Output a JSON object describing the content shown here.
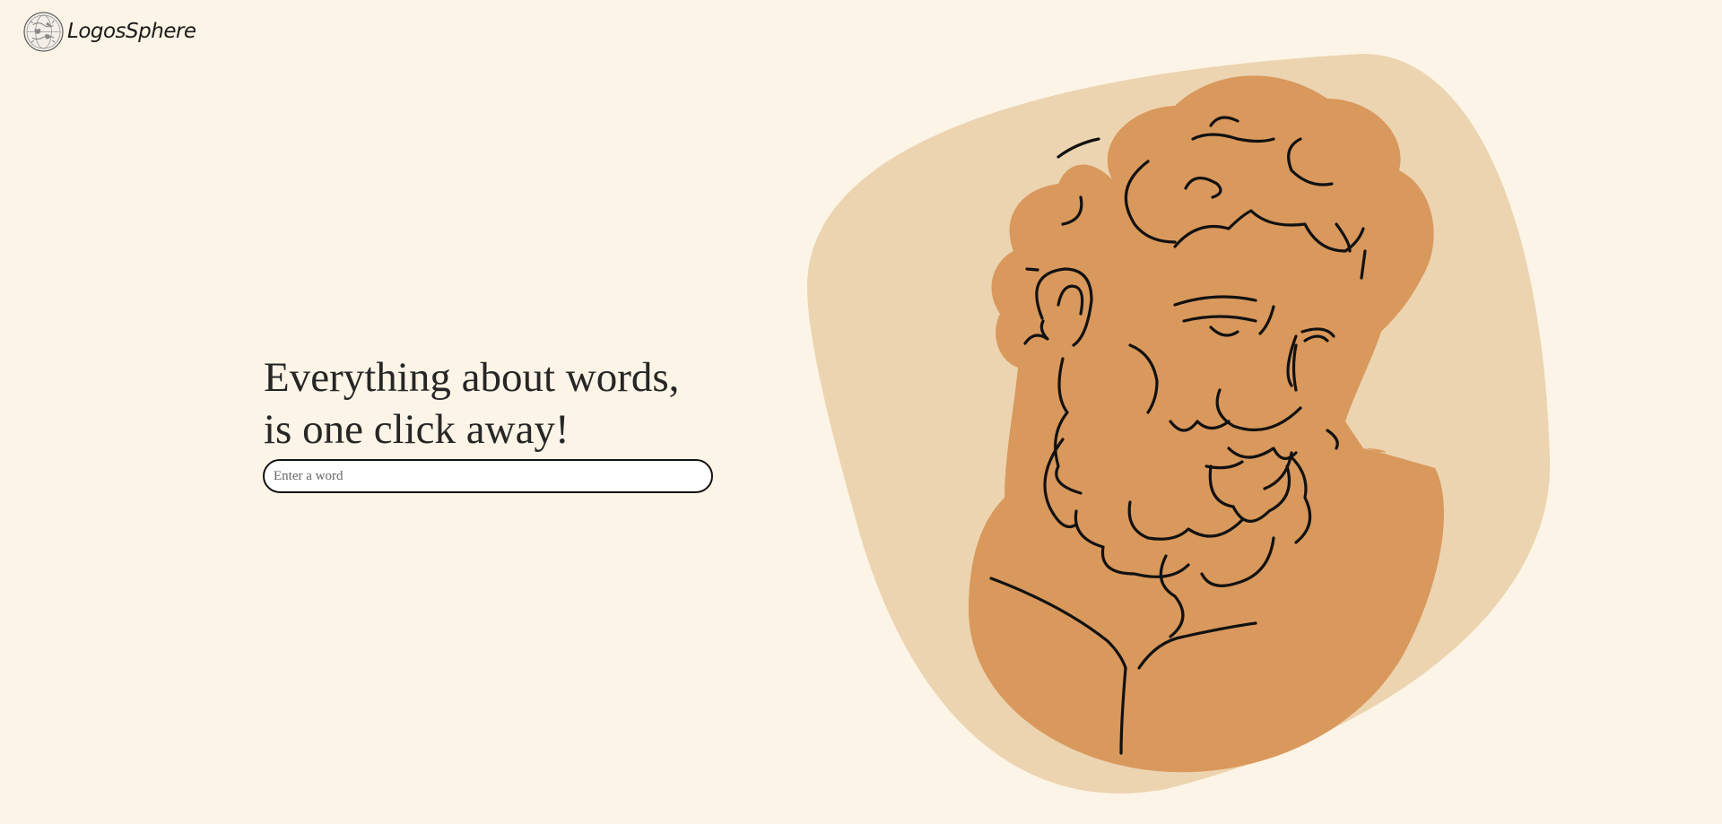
{
  "brand": {
    "name": "LogosSphere",
    "logo_icon": "globe-engraving-icon"
  },
  "hero": {
    "title_line1": "Everything about words,",
    "title_line2": "is one click away!"
  },
  "search": {
    "placeholder": "Enter a word",
    "value": ""
  },
  "illustration": {
    "subject": "bearded-philosopher-bust-icon",
    "colors": {
      "background": "#fcf4e6",
      "blob": "#ecd4b0",
      "bust": "#d9985c",
      "line": "#111111"
    }
  }
}
